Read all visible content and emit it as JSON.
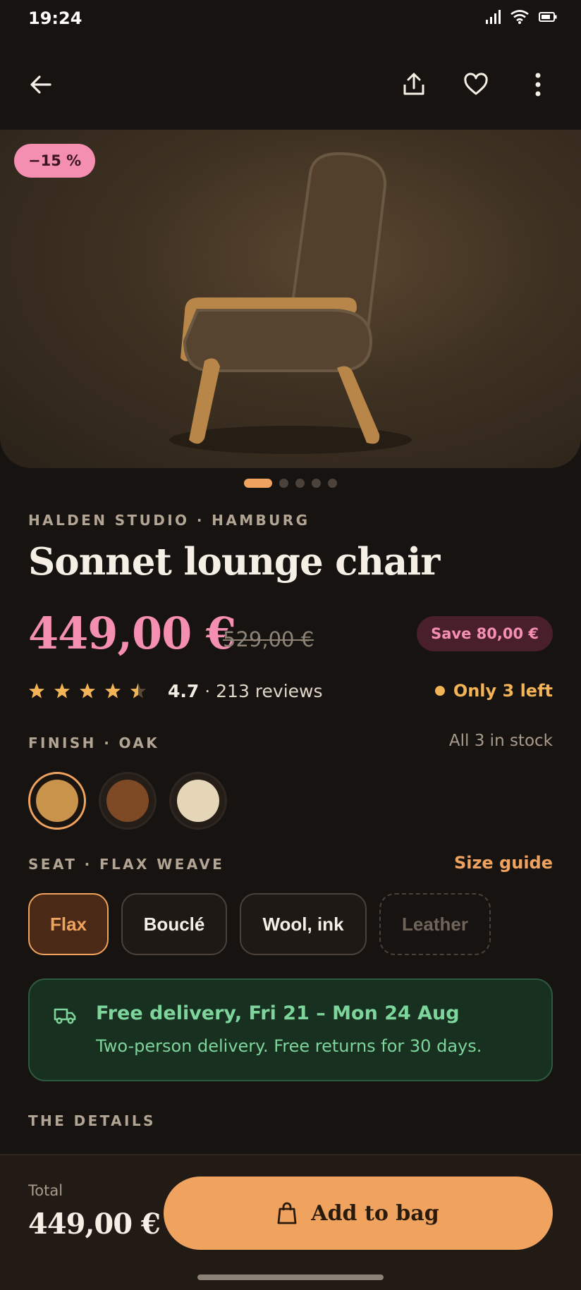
{
  "status_bar": {
    "time": "19:24"
  },
  "hero": {
    "discount_badge": "−15 %",
    "carousel_dots": 5,
    "active_dot": 0
  },
  "product": {
    "brand": "HALDEN STUDIO · HAMBURG",
    "title": "Sonnet lounge chair",
    "price": "449,00 €",
    "old_price": "529,00 €",
    "save_badge": "Save 80,00 €",
    "rating_value": "4.7",
    "rating_count": "· 213 reviews",
    "stars": 4.5,
    "stock_note": "Only 3 left"
  },
  "finish": {
    "label": "FINISH · OAK",
    "stock": "All 3 in stock",
    "swatches": [
      {
        "color": "#c9934c",
        "selected": true
      },
      {
        "color": "#7e4a25",
        "selected": false
      },
      {
        "color": "#e6d6b8",
        "selected": false
      }
    ]
  },
  "seat": {
    "label": "SEAT · FLAX WEAVE",
    "size_guide": "Size guide",
    "options": [
      {
        "label": "Flax",
        "state": "selected"
      },
      {
        "label": "Bouclé",
        "state": "default"
      },
      {
        "label": "Wool, ink",
        "state": "default"
      },
      {
        "label": "Leather",
        "state": "disabled"
      }
    ]
  },
  "delivery": {
    "title": "Free delivery, Fri 21 – Mon 24 Aug",
    "subtitle": "Two-person delivery. Free returns for 30 days."
  },
  "details": {
    "label": "THE DETAILS"
  },
  "bottom_bar": {
    "total_label": "Total",
    "total_value": "449,00 €",
    "add_button": "Add to bag"
  },
  "colors": {
    "background": "#171310",
    "accent": "#f0a35e",
    "sale": "#f58fb1",
    "success": "#7ed59b"
  }
}
